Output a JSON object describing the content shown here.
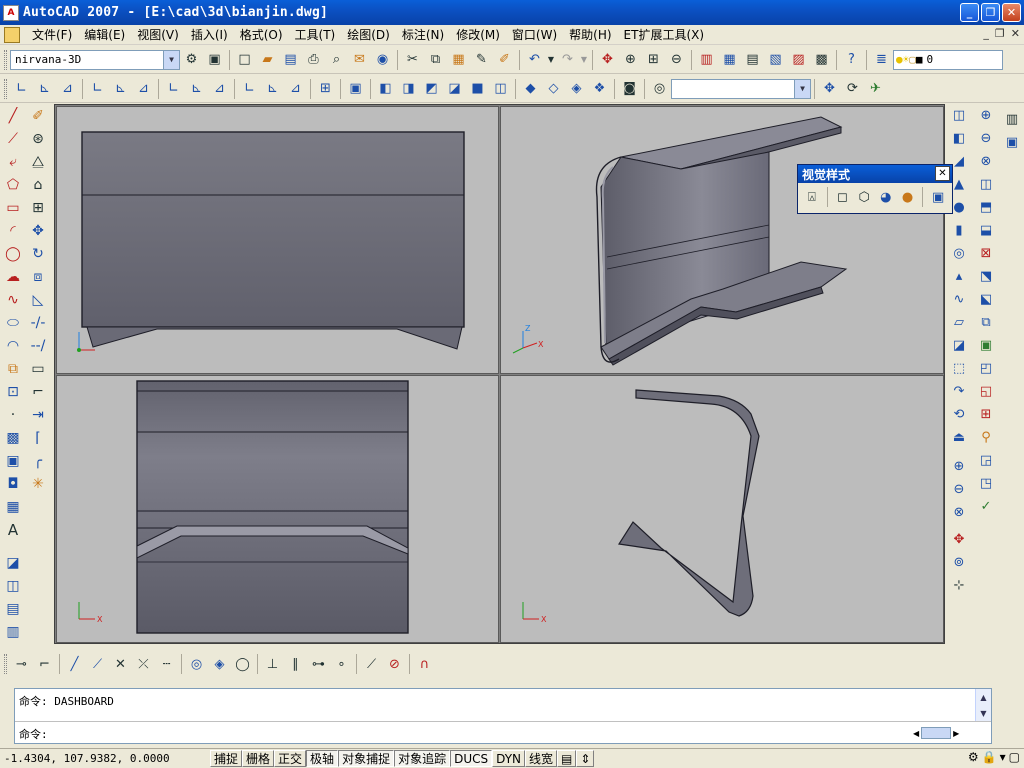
{
  "window": {
    "app_icon": "A",
    "title": "AutoCAD 2007 - [E:\\cad\\3d\\bianjin.dwg]",
    "controls": [
      "_",
      "❐",
      "✕"
    ]
  },
  "menubar": {
    "items": [
      "文件(F)",
      "编辑(E)",
      "视图(V)",
      "插入(I)",
      "格式(O)",
      "工具(T)",
      "绘图(D)",
      "标注(N)",
      "修改(M)",
      "窗口(W)",
      "帮助(H)",
      "ET扩展工具(X)"
    ],
    "mdi_controls": [
      "_",
      "❐",
      "✕"
    ]
  },
  "toolbar": {
    "workspace": "nirvana-3D",
    "layer_value": "0"
  },
  "visual_styles_panel": {
    "title": "视觉样式",
    "close": "✕"
  },
  "command": {
    "history": "命令: DASHBOARD",
    "prompt": "命令:"
  },
  "status": {
    "coordinates": "-1.4304, 107.9382, 0.0000",
    "buttons": [
      {
        "label": "捕捉",
        "on": false
      },
      {
        "label": "栅格",
        "on": false
      },
      {
        "label": "正交",
        "on": false
      },
      {
        "label": "极轴",
        "on": true
      },
      {
        "label": "对象捕捉",
        "on": true
      },
      {
        "label": "对象追踪",
        "on": true
      },
      {
        "label": "DUCS",
        "on": true
      },
      {
        "label": "DYN",
        "on": false
      },
      {
        "label": "线宽",
        "on": false
      }
    ]
  },
  "colors": {
    "title_blue": "#0b4fc0",
    "viewport_bg": "#bcbcbc",
    "model_face": "#6e6e7a",
    "model_edge": "#1e1e28"
  },
  "icons": {
    "std": [
      "new-icon",
      "open-icon",
      "save-icon",
      "print-icon",
      "preview-icon",
      "publish-icon",
      "cut-icon",
      "copy-icon",
      "paste-icon",
      "match-icon",
      "undo-icon",
      "redo-icon",
      "pan-icon",
      "zoom-icon",
      "zoom-window-icon",
      "zoom-prev-icon",
      "properties-icon",
      "design-center-icon",
      "tool-palette-icon",
      "sheet-set-icon",
      "markup-icon",
      "calculator-icon",
      "help-icon"
    ]
  }
}
